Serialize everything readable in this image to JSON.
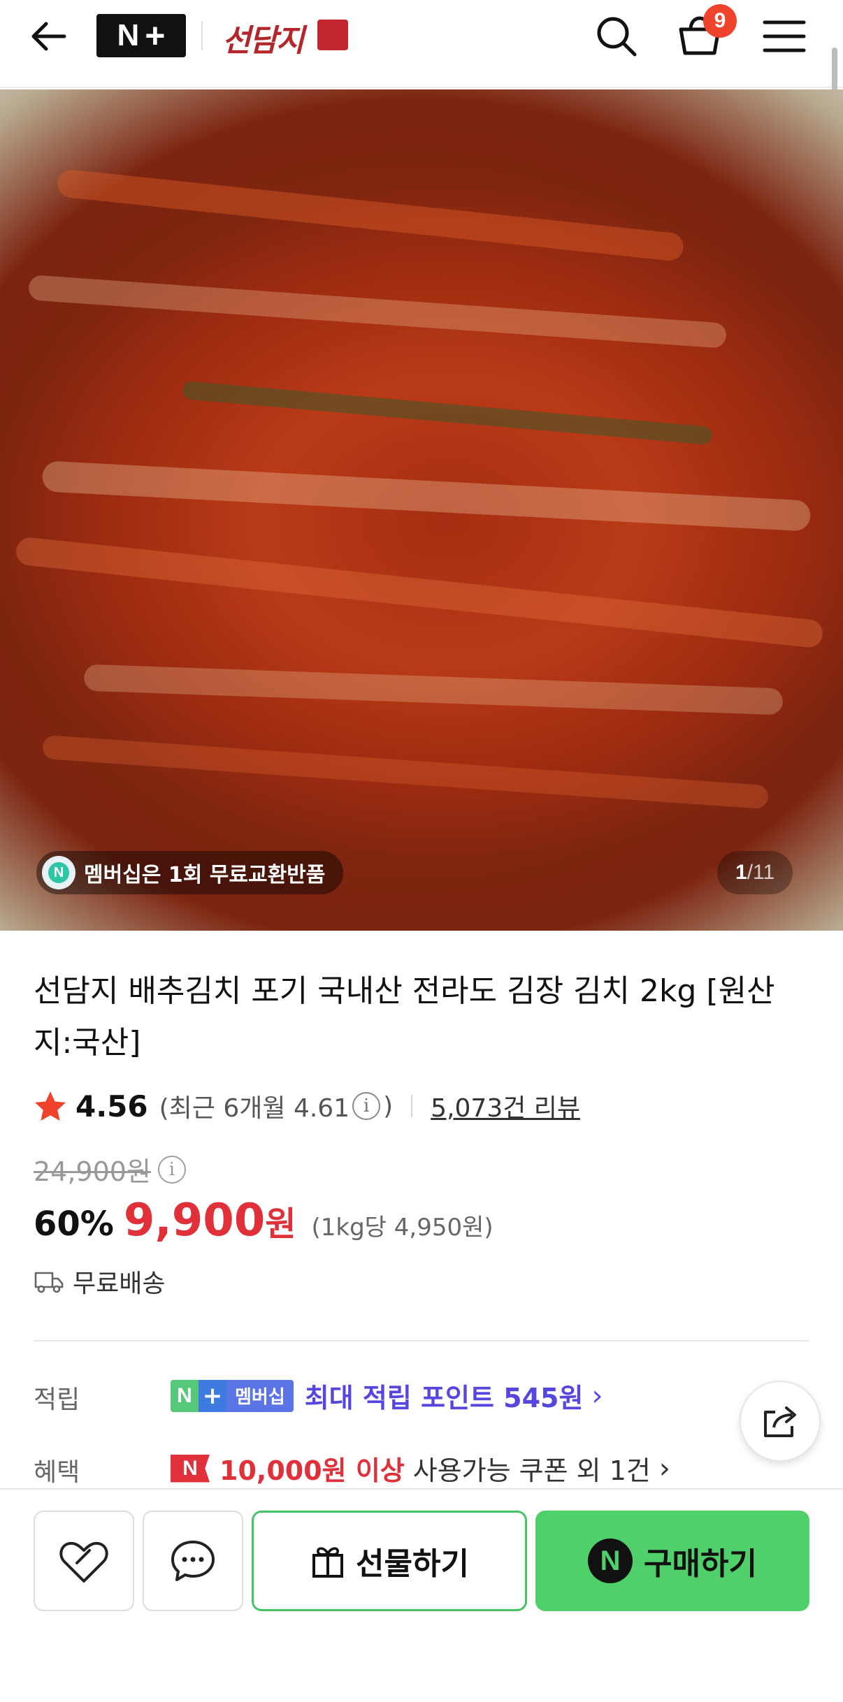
{
  "header": {
    "nplus_logo": {
      "n": "N",
      "plus": "+"
    },
    "brand_name": "선담지",
    "cart_count": "9",
    "icons": [
      "back-icon",
      "search-icon",
      "cart-icon",
      "menu-icon"
    ]
  },
  "gallery": {
    "membership_text": "멤버십은 1회 무료교환반품",
    "membership_icon_letter": "N",
    "page_current": "1",
    "page_separator": "/",
    "page_total": "11"
  },
  "product": {
    "title": "선담지 배추김치 포기 국내산 전라도 김장 김치 2kg [원산지:국산]",
    "rating": "4.56",
    "recent_rating": "(최근 6개월 4.61",
    "recent_close": ")",
    "review_link": "5,073건 리뷰",
    "original_price": "24,900원",
    "discount": "60%",
    "sale_price": "9,900",
    "won": "원",
    "unit_price": "(1kg당 4,950원)",
    "shipping": "무료배송"
  },
  "benefits": {
    "points_label": "적립",
    "membership_badge_n": "N",
    "membership_badge_plus": "+",
    "membership_badge_text": "멤버십",
    "points_text": "최대 적립 포인트 545원",
    "benefit_label": "혜택",
    "coupon_badge": "N",
    "coupon_strong": "10,000원 이상",
    "coupon_rest": "사용가능 쿠폰 외 1건",
    "chevron": "›"
  },
  "bottom_bar": {
    "gift_label": "선물하기",
    "buy_label": "구매하기",
    "buy_badge": "N"
  },
  "colors": {
    "accent_red": "#e0303a",
    "points_purple": "#5546e0",
    "buy_green": "#4fd06a",
    "cart_badge": "#f0432b"
  }
}
